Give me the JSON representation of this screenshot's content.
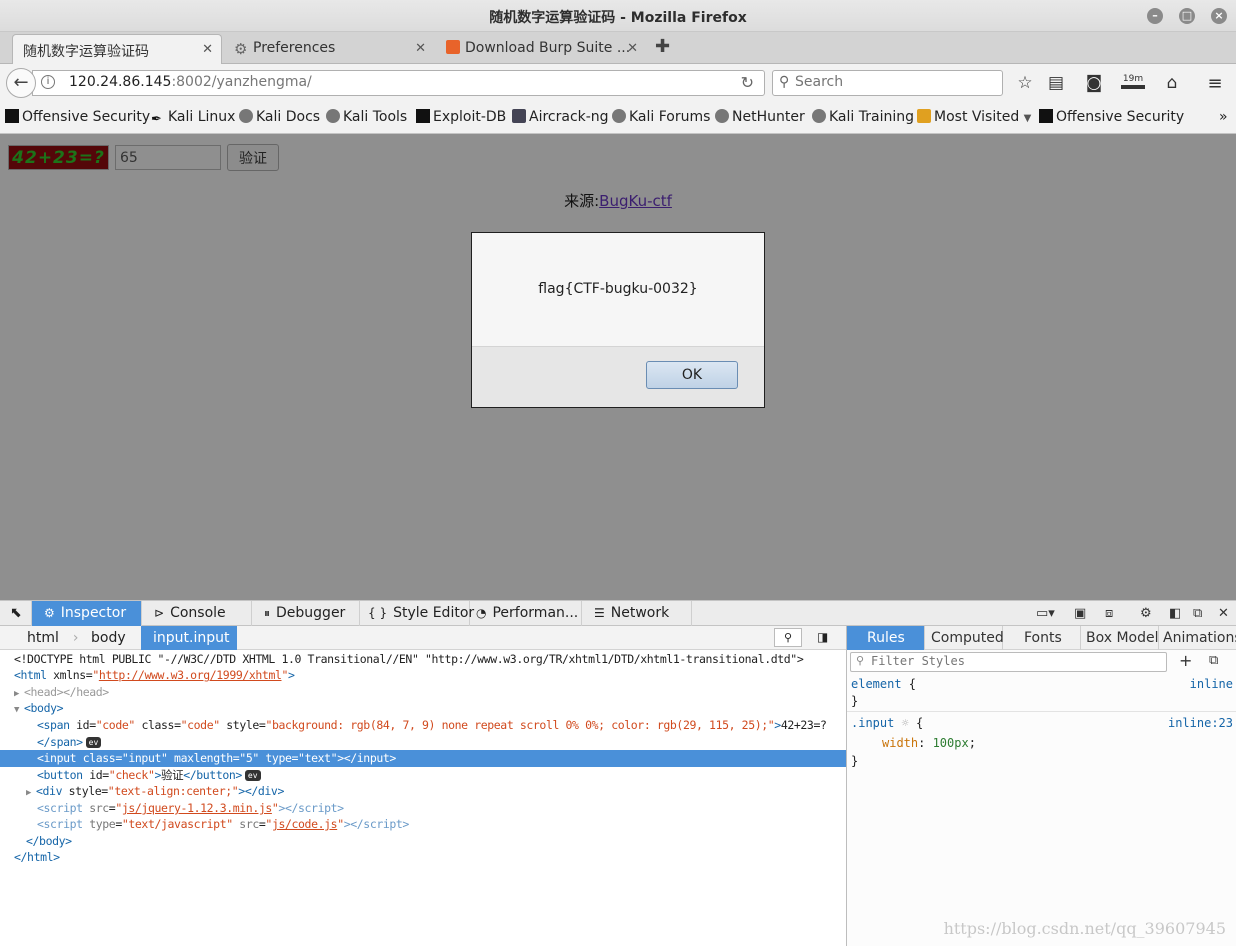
{
  "window": {
    "title": "随机数字运算验证码 - Mozilla Firefox"
  },
  "tabs": [
    {
      "label": "随机数字运算验证码",
      "active": true
    },
    {
      "label": "Preferences",
      "active": false
    },
    {
      "label": "Download Burp Suite ...",
      "active": false
    }
  ],
  "urlbar": {
    "host": "120.24.86.145",
    "rest": ":8002/yanzhengma/"
  },
  "search": {
    "placeholder": "Search"
  },
  "nav": {
    "timer_badge": "19m"
  },
  "bookmarks": [
    "Offensive Security",
    "Kali Linux",
    "Kali Docs",
    "Kali Tools",
    "Exploit-DB",
    "Aircrack-ng",
    "Kali Forums",
    "NetHunter",
    "Kali Training",
    "Most Visited",
    "Offensive Security"
  ],
  "page": {
    "captcha": "42+23=?",
    "answer_value": "65",
    "verify_label": "验证",
    "source_prefix": "来源:",
    "source_link": "BugKu-ctf"
  },
  "dialog": {
    "message": "flag{CTF-bugku-0032}",
    "ok_label": "OK"
  },
  "devtools": {
    "tabs": [
      "Inspector",
      "Console",
      "Debugger",
      "Style Editor",
      "Performan...",
      "Network"
    ],
    "breadcrumbs": [
      "html",
      "body",
      "input.input"
    ],
    "markup": {
      "doctype": "<!DOCTYPE html PUBLIC \"-//W3C//DTD XHTML 1.0 Transitional//EN\" \"http://www.w3.org/TR/xhtml1/DTD/xhtml1-transitional.dtd\">",
      "xmlns": "http://www.w3.org/1999/xhtml",
      "span_style": "background: rgb(84, 7, 9) none repeat scroll 0% 0%; color: rgb(29, 115, 25);",
      "span_text": "42+23=?",
      "button_text": "验证",
      "div_style": "text-align:center;",
      "script1_src": "js/jquery-1.12.3.min.js",
      "script2_type": "text/javascript",
      "script2_src": "js/code.js"
    },
    "side_tabs": [
      "Rules",
      "Computed",
      "Fonts",
      "Box Model",
      "Animations"
    ],
    "filter_placeholder": "Filter Styles",
    "rules": {
      "r1_selector": "element",
      "r1_source": "inline",
      "r2_selector": ".input",
      "r2_source": "inline:23",
      "r2_prop": "width",
      "r2_value": "100px"
    }
  },
  "watermark": "https://blog.csdn.net/qq_39607945"
}
